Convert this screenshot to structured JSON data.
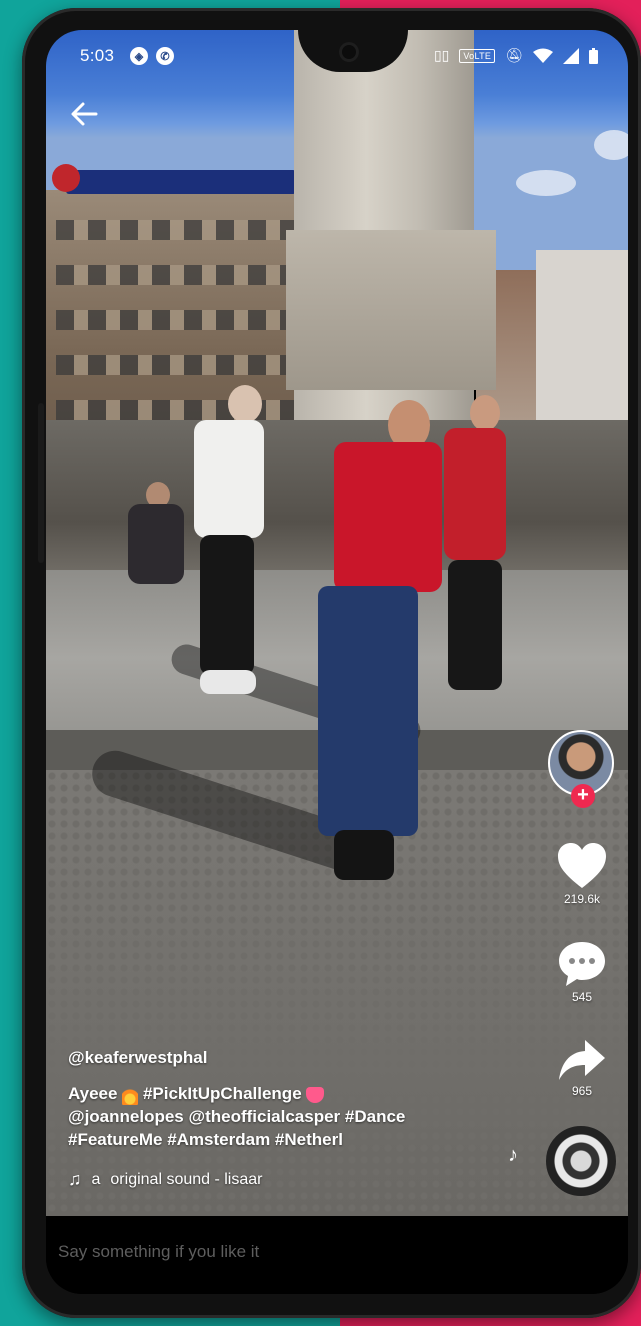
{
  "status_bar": {
    "time": "5:03",
    "left_icons": [
      "compass-icon",
      "whatsapp-icon"
    ],
    "right_icons": [
      "vibrate-icon",
      "volte-icon",
      "mute-bell-icon",
      "wifi-icon",
      "signal-icon",
      "battery-icon"
    ],
    "volte_label": "VoLTE"
  },
  "video": {
    "author": "@keaferwestphal",
    "caption_lines": [
      "Ayeee",
      "#PickItUpChallenge",
      "@joannelopes @theofficialcasper #Dance",
      "#FeatureMe #Amsterdam #Netherl"
    ],
    "sound_prefix": "a",
    "sound_label": "original sound - lisaar"
  },
  "actions": {
    "likes": "219.6k",
    "comments": "545",
    "shares": "965"
  },
  "comment_bar": {
    "placeholder": "Say something if you like it"
  },
  "colors": {
    "bg_left": "#10a49b",
    "bg_right": "#e3205a",
    "follow_badge": "#ef2950"
  }
}
